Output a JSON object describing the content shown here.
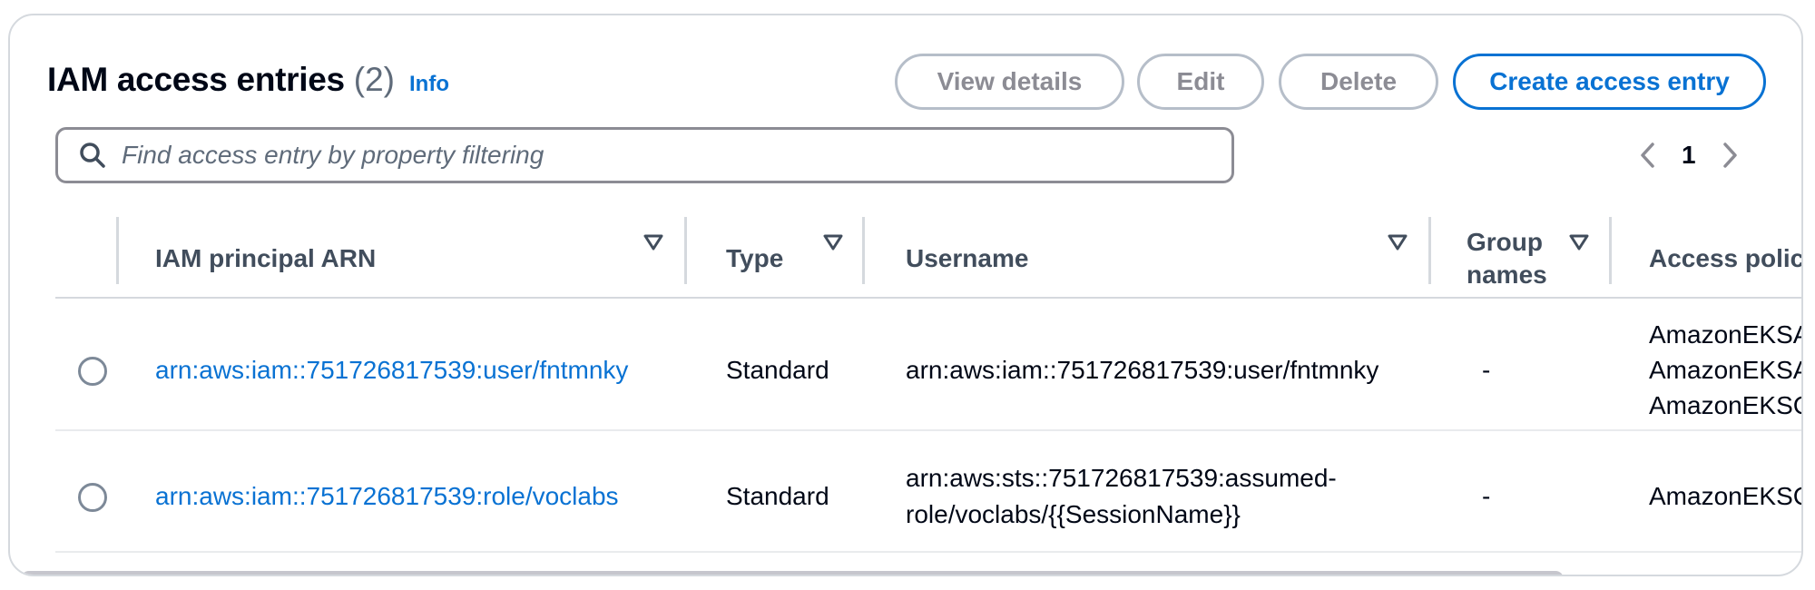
{
  "header": {
    "title": "IAM access entries",
    "count": "(2)",
    "info_label": "Info"
  },
  "actions": {
    "view_details": "View details",
    "edit": "Edit",
    "delete": "Delete",
    "create": "Create access entry"
  },
  "search": {
    "placeholder": "Find access entry by property filtering",
    "value": ""
  },
  "pagination": {
    "current_page": "1"
  },
  "table": {
    "columns": {
      "arn": "IAM principal ARN",
      "type": "Type",
      "username": "Username",
      "group_line1": "Group",
      "group_line2": "names",
      "policies": "Access polici"
    },
    "rows": [
      {
        "arn": "arn:aws:iam::751726817539:user/fntmnky",
        "type": "Standard",
        "username_line1": "arn:aws:iam::751726817539:user/fntmnky",
        "username_line2": "",
        "group_names": "-",
        "policies": [
          "AmazonEKSA",
          "AmazonEKSA",
          "AmazonEKSC"
        ]
      },
      {
        "arn": "arn:aws:iam::751726817539:role/voclabs",
        "type": "Standard",
        "username_line1": "arn:aws:sts::751726817539:assumed-",
        "username_line2": "role/voclabs/{{SessionName}}",
        "group_names": "-",
        "policies": [
          "AmazonEKSC"
        ]
      }
    ]
  },
  "icons": {
    "search": "search-icon",
    "sort": "sort-caret-down-icon",
    "prev": "chevron-left-icon",
    "next": "chevron-right-icon"
  },
  "colors": {
    "link": "#0972d3",
    "text": "#000716",
    "disabled_border": "#b6bec9",
    "divider": "#d5d9de"
  }
}
